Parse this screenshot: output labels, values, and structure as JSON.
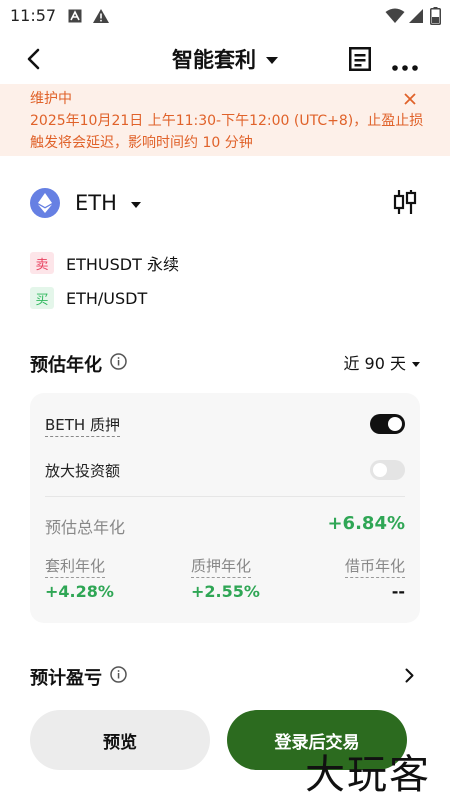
{
  "status_bar": {
    "time": "11:57",
    "icons": [
      "font-a-icon",
      "warning-icon",
      "wifi-icon",
      "signal-icon",
      "battery-icon"
    ]
  },
  "nav": {
    "title": "智能套利",
    "icons": [
      "back-arrow-icon",
      "caret-down-icon",
      "order-record-icon",
      "more-icon"
    ]
  },
  "banner": {
    "title": "维护中",
    "text": "2025年10月21日 上午11:30-下午12:00 (UTC+8)，止盈止损触发将会延迟，影响时间约 10 分钟"
  },
  "asset": {
    "name": "ETH",
    "pairs": [
      {
        "badge": "卖",
        "text": "ETHUSDT 永续"
      },
      {
        "badge": "买",
        "text": "ETH/USDT"
      }
    ]
  },
  "estimate": {
    "title": "预估年化",
    "period": "近 90 天",
    "options": [
      {
        "label": "BETH 质押",
        "on": true
      },
      {
        "label": "放大投资额",
        "on": false
      }
    ],
    "total_label": "预估总年化",
    "total_value": "+6.84%",
    "breakdown": [
      {
        "label": "套利年化",
        "value": "+4.28%"
      },
      {
        "label": "质押年化",
        "value": "+2.55%"
      },
      {
        "label": "借币年化",
        "value": "--"
      }
    ]
  },
  "pnl": {
    "title": "预计盈亏"
  },
  "actions": {
    "preview": "预览",
    "trade": "登录后交易"
  },
  "watermark": "大玩客",
  "colors": {
    "banner_bg": "#fdf0e9",
    "banner_text": "#e0622a",
    "positive": "#2fa655",
    "sell": "#e8415f",
    "buy": "#2fb85d",
    "primary_button": "#2c6b1f",
    "eth_blue": "#6680e3"
  }
}
